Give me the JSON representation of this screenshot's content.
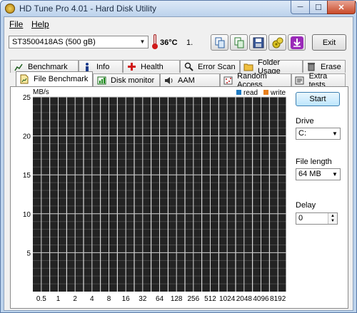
{
  "window": {
    "title": "HD Tune Pro 4.01 - Hard Disk Utility",
    "controls": {
      "minimize": "─",
      "maximize": "☐",
      "close": "✕"
    }
  },
  "menu": {
    "file": "File",
    "help": "Help"
  },
  "toolbar": {
    "drive_selected": "ST3500418AS (500 gB)",
    "temperature": "36°C",
    "drive_number": "1.",
    "buttons": [
      "copy-info-icon",
      "copy-text-icon",
      "save-icon",
      "options-icon",
      "download-icon"
    ],
    "exit_label": "Exit"
  },
  "tabs_row1": [
    {
      "label": "Benchmark",
      "icon": "benchmark-icon"
    },
    {
      "label": "Info",
      "icon": "info-icon"
    },
    {
      "label": "Health",
      "icon": "health-icon"
    },
    {
      "label": "Error Scan",
      "icon": "magnifier-icon"
    },
    {
      "label": "Folder Usage",
      "icon": "folder-icon"
    },
    {
      "label": "Erase",
      "icon": "trash-icon"
    }
  ],
  "tabs_row2": [
    {
      "label": "File Benchmark",
      "icon": "file-benchmark-icon",
      "active": true
    },
    {
      "label": "Disk monitor",
      "icon": "disk-monitor-icon"
    },
    {
      "label": "AAM",
      "icon": "speaker-icon"
    },
    {
      "label": "Random Access",
      "icon": "random-access-icon"
    },
    {
      "label": "Extra tests",
      "icon": "extra-tests-icon"
    }
  ],
  "chart_data": {
    "type": "bar",
    "ylabel": "MB/s",
    "ylim": [
      0,
      25
    ],
    "yticks": [
      5,
      10,
      15,
      20,
      25
    ],
    "categories": [
      "0.5",
      "1",
      "2",
      "4",
      "8",
      "16",
      "32",
      "64",
      "128",
      "256",
      "512",
      "1024",
      "2048",
      "4096",
      "8192"
    ],
    "series": [
      {
        "name": "read",
        "color": "#1f7bc2",
        "values": []
      },
      {
        "name": "write",
        "color": "#e8801e",
        "values": []
      }
    ],
    "grid": true,
    "legend": "top-right"
  },
  "side": {
    "start_label": "Start",
    "drive_label": "Drive",
    "drive_value": "C:",
    "file_length_label": "File length",
    "file_length_value": "64 MB",
    "delay_label": "Delay",
    "delay_value": "0"
  },
  "colors": {
    "plot_background": "#232323",
    "grid": "#ffffff",
    "accent": "#3c7fb1"
  }
}
